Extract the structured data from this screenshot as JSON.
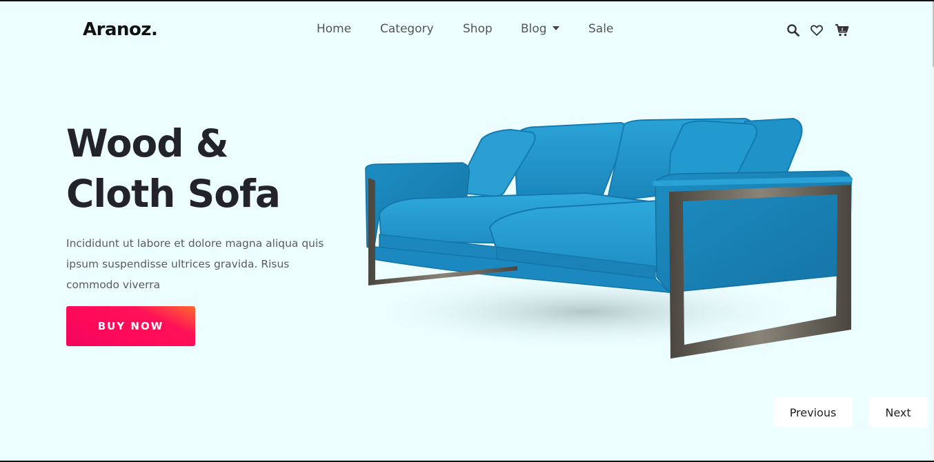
{
  "brand": {
    "logo": "Aranoz."
  },
  "nav": {
    "items": [
      {
        "label": "Home"
      },
      {
        "label": "Category"
      },
      {
        "label": "Shop"
      },
      {
        "label": "Blog"
      },
      {
        "label": "Sale"
      }
    ]
  },
  "header_icons": [
    "search-icon",
    "heart-icon",
    "cart-icon"
  ],
  "hero": {
    "title_line1": "Wood &",
    "title_line2": "Cloth Sofa",
    "description": "Incididunt ut labore et dolore magna aliqua quis ipsum suspendisse ultrices gravida. Risus commodo viverra",
    "cta_label": "BUY NOW"
  },
  "slider": {
    "previous_label": "Previous",
    "next_label": "Next"
  },
  "colors": {
    "background": "#ecfeff",
    "cta_gradient_start": "#ff6a2f",
    "cta_gradient_end": "#f0065e",
    "sofa_blue": "#1f8fc4",
    "frame_metal": "#5f5a52"
  }
}
